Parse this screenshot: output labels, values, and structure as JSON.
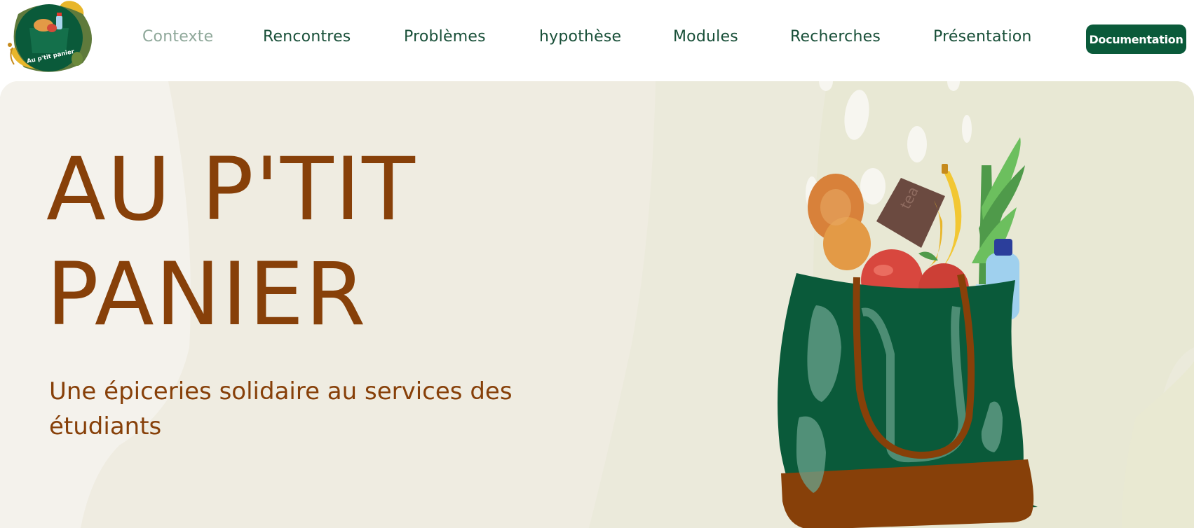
{
  "header": {
    "logo_text": "Au p'tit panier",
    "nav": [
      {
        "label": "Contexte",
        "active": true
      },
      {
        "label": "Rencontres",
        "active": false
      },
      {
        "label": "Problèmes",
        "active": false
      },
      {
        "label": "hypothèse",
        "active": false
      },
      {
        "label": "Modules",
        "active": false
      },
      {
        "label": "Recherches",
        "active": false
      },
      {
        "label": "Présentation",
        "active": false
      }
    ],
    "cta_label": "Documentation"
  },
  "hero": {
    "title_line1": "AU P'TIT",
    "title_line2": "PANIER",
    "subtitle_line1": "Une épiceries solidaire au services des",
    "subtitle_line2": "étudiants",
    "bag_text": "tea"
  },
  "colors": {
    "brand_green": "#0a5a3a",
    "nav_text": "#184f38",
    "nav_active": "#8fa89a",
    "title_brown": "#874009",
    "hero_bg": "#efece1"
  }
}
